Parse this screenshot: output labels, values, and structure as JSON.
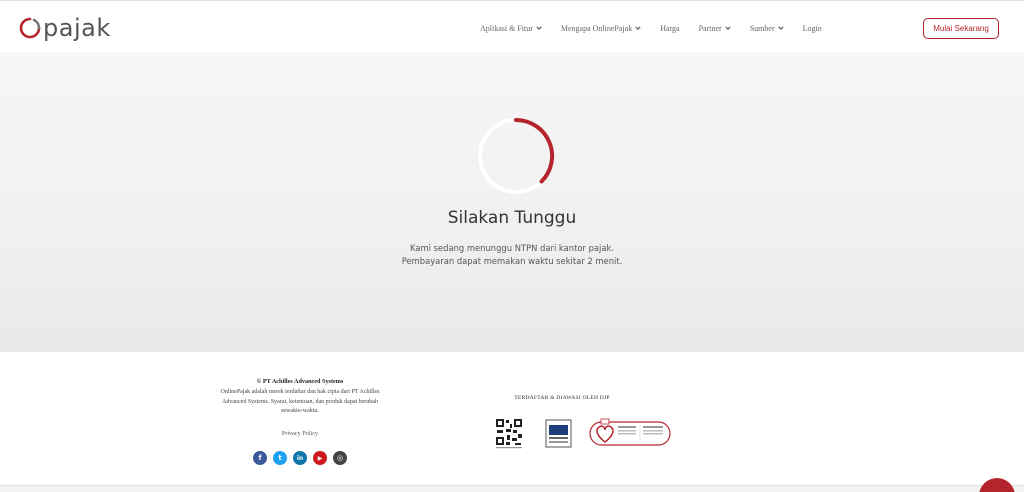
{
  "header": {
    "logo_text": "pajak",
    "nav": [
      {
        "label": "Aplikasi & Fitur",
        "dropdown": true
      },
      {
        "label": "Mengapa OnlinePajak",
        "dropdown": true
      },
      {
        "label": "Harga",
        "dropdown": false
      },
      {
        "label": "Partner",
        "dropdown": true
      },
      {
        "label": "Sumber",
        "dropdown": true
      },
      {
        "label": "Login",
        "dropdown": false
      }
    ],
    "cta_label": "Mulai Sekarang"
  },
  "main": {
    "title": "Silakan Tunggu",
    "message_line1": "Kami sedang menunggu NTPN dari kantor pajak.",
    "message_line2": "Pembayaran dapat memakan waktu sekitar 2 menit."
  },
  "footer": {
    "company": "© PT Achilles Advanced Systems",
    "description": "OnlinePajak adalah merek terdaftar dan hak cipta dari PT Achilles Advanced Systems. Syarat, ketentuan, dan produk dapat berubah sewaktu-waktu.",
    "privacy_label": "Privacy Policy",
    "socials": [
      {
        "icon": "facebook-icon",
        "glyph": "f",
        "color": "#3b5998"
      },
      {
        "icon": "twitter-icon",
        "glyph": "t",
        "color": "#1da1f2"
      },
      {
        "icon": "linkedin-icon",
        "glyph": "in",
        "color": "#0e76a8"
      },
      {
        "icon": "youtube-icon",
        "glyph": "▶",
        "color": "#cc181e"
      },
      {
        "icon": "instagram-icon",
        "glyph": "◎",
        "color": "#444444"
      }
    ],
    "registered_title": "TERDAFTAR & DIAWASI OLEH DJP"
  },
  "colors": {
    "accent": "#b5242c",
    "text": "#333333"
  }
}
